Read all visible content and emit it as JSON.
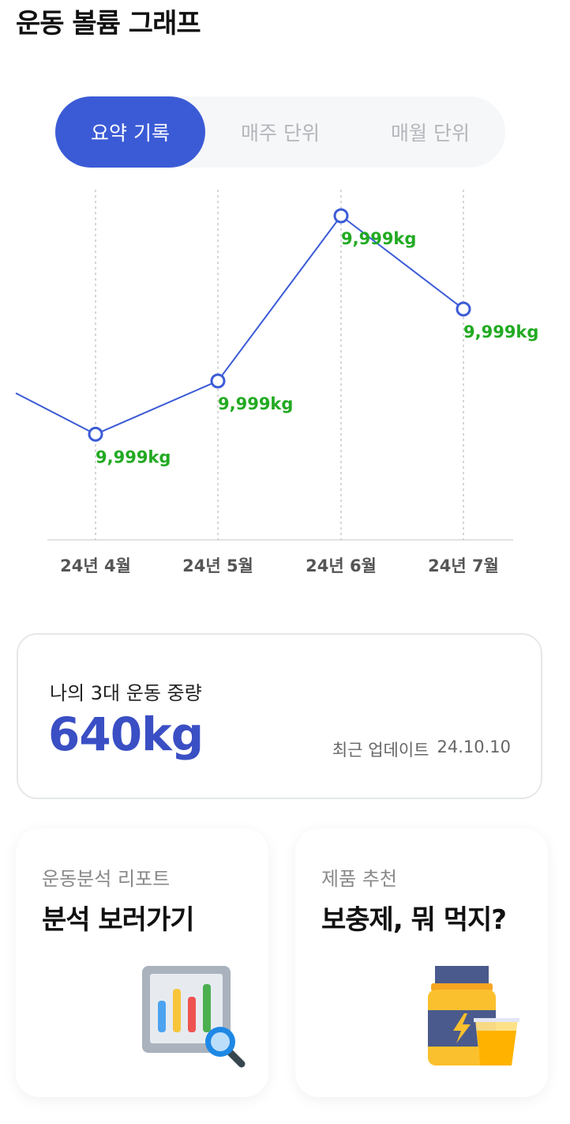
{
  "page": {
    "title": "운동 볼륨 그래프"
  },
  "tabs": [
    {
      "label": "요약 기록",
      "active": true
    },
    {
      "label": "매주 단위",
      "active": false
    },
    {
      "label": "매월 단위",
      "active": false
    }
  ],
  "colors": {
    "accent": "#3b5bd6",
    "value_text": "#3a4fc4",
    "data_label": "#22aa22",
    "inactive_tab": "#b3b6bb"
  },
  "chart_data": {
    "type": "line",
    "categories": [
      "24년 4월",
      "24년 5월",
      "24년 6월",
      "24년 7월"
    ],
    "values": [
      9999,
      9999,
      9999,
      9999
    ],
    "data_labels": [
      "9,999kg",
      "9,999kg",
      "9,999kg",
      "9,999kg"
    ],
    "relative_levels": [
      0.18,
      0.38,
      1.0,
      0.65
    ],
    "grid": "vertical dashed lines at each category",
    "title": "",
    "xlabel": "",
    "ylabel": ""
  },
  "summary": {
    "label": "나의 3대 운동 중량",
    "value": "640kg",
    "update_label": "최근 업데이트",
    "update_date": "24.10.10"
  },
  "tiles": [
    {
      "subtitle": "운동분석 리포트",
      "title": "분석 보러가기",
      "icon": "bar-chart-report-icon"
    },
    {
      "subtitle": "제품 추천",
      "title": "보충제, 뭐 먹지?",
      "icon": "supplement-jar-icon"
    }
  ]
}
